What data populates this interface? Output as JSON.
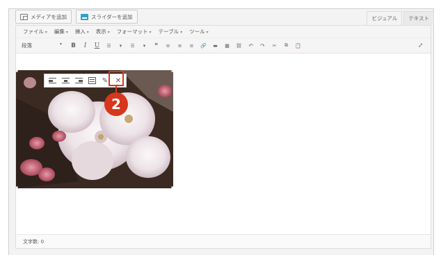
{
  "media_buttons": {
    "add_media_label": "メディアを追加",
    "add_slider_label": "スライダーを追加"
  },
  "mode_tabs": {
    "visual": "ビジュアル",
    "text": "テキスト"
  },
  "menubar": {
    "items": [
      "ファイル",
      "編集",
      "挿入",
      "表示",
      "フォーマット",
      "テーブル",
      "ツール"
    ]
  },
  "toolbar": {
    "format_value": "段落",
    "bold": "B",
    "italic": "I",
    "underline": "U",
    "bullet_list": "☰",
    "number_list": "☰",
    "blockquote": "❝",
    "align_left": "≡",
    "align_center": "≡",
    "align_right": "≡",
    "link": "🔗",
    "hr": "▬",
    "table": "▦",
    "unlink": "⛓",
    "undo": "↶",
    "redo": "↷",
    "cut": "✂",
    "copy": "⧉",
    "paste": "📋",
    "fullscreen": "⤢"
  },
  "image_toolbar": {
    "edit_icon": "✎",
    "remove_icon": "✕"
  },
  "annotation": {
    "marker_number": "2",
    "color": "#d6371c"
  },
  "statusbar": {
    "word_count": "文字数: 0"
  }
}
